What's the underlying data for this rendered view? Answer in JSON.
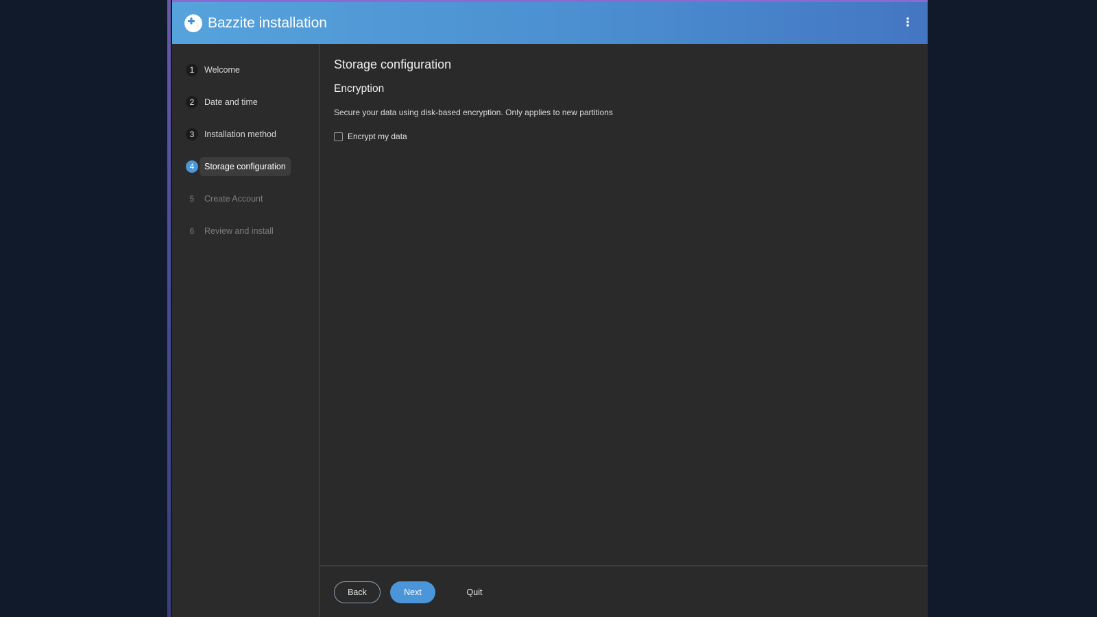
{
  "header": {
    "title": "Bazzite installation",
    "logo_icon": "bazzite-logo-icon",
    "menu_icon": "kebab-menu-icon",
    "gradient_start": "#56a3dc",
    "gradient_end": "#4476c2"
  },
  "sidebar": {
    "items": [
      {
        "number": "1",
        "label": "Welcome",
        "state": "done"
      },
      {
        "number": "2",
        "label": "Date and time",
        "state": "done"
      },
      {
        "number": "3",
        "label": "Installation method",
        "state": "done"
      },
      {
        "number": "4",
        "label": "Storage configuration",
        "state": "current"
      },
      {
        "number": "5",
        "label": "Create Account",
        "state": "pending"
      },
      {
        "number": "6",
        "label": "Review and install",
        "state": "pending"
      }
    ]
  },
  "main": {
    "page_title": "Storage configuration",
    "section_title": "Encryption",
    "description": "Secure your data using disk-based encryption. Only applies to new partitions",
    "checkbox": {
      "label": "Encrypt my data",
      "checked": false
    }
  },
  "footer": {
    "back_label": "Back",
    "next_label": "Next",
    "quit_label": "Quit"
  },
  "colors": {
    "accent": "#4b96d8",
    "background": "#2a2a2a"
  }
}
